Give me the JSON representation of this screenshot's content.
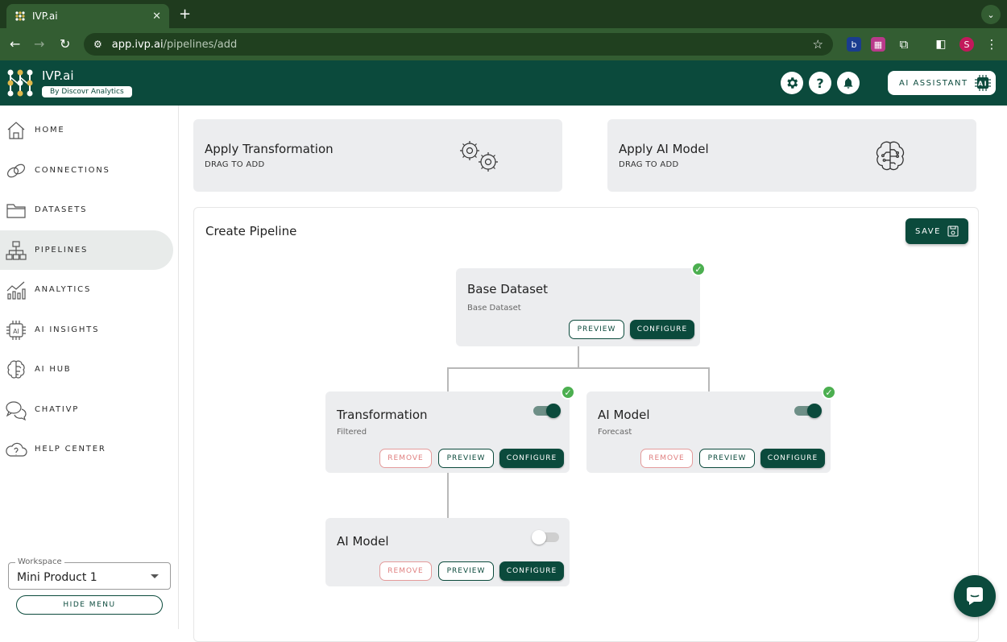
{
  "browser": {
    "tab_title": "IVP.ai",
    "tab_close": "✕",
    "new_tab": "+",
    "url_host": "app.ivp.ai",
    "url_path": "/pipelines/add",
    "profile_initial": "S"
  },
  "app": {
    "brand": "IVP.ai",
    "byline": "By Discovr Analytics",
    "ai_assistant_label": "AI ASSISTANT",
    "accent_color": "#0b4a3c"
  },
  "sidebar": {
    "items": [
      {
        "label": "HOME",
        "icon": "home-icon"
      },
      {
        "label": "CONNECTIONS",
        "icon": "link-icon"
      },
      {
        "label": "DATASETS",
        "icon": "folder-icon"
      },
      {
        "label": "PIPELINES",
        "icon": "pipeline-icon",
        "active": true
      },
      {
        "label": "ANALYTICS",
        "icon": "chart-icon"
      },
      {
        "label": "AI INSIGHTS",
        "icon": "ai-chip-icon"
      },
      {
        "label": "AI HUB",
        "icon": "brain-icon"
      },
      {
        "label": "CHATIVP",
        "icon": "chat-bubbles-icon"
      },
      {
        "label": "HELP CENTER",
        "icon": "cloud-icon"
      }
    ],
    "workspace_legend": "Workspace",
    "workspace_value": "Mini Product 1",
    "hide_menu": "HIDE MENU"
  },
  "drag_cards": [
    {
      "title": "Apply Transformation",
      "subtitle": "DRAG TO ADD",
      "icon": "gears-icon"
    },
    {
      "title": "Apply AI Model",
      "subtitle": "DRAG TO ADD",
      "icon": "brain-icon"
    }
  ],
  "pipeline": {
    "title": "Create Pipeline",
    "save_label": "SAVE",
    "nodes": {
      "base": {
        "title": "Base Dataset",
        "subtitle": "Base Dataset",
        "preview": "PREVIEW",
        "configure": "CONFIGURE",
        "checked": true
      },
      "transform": {
        "title": "Transformation",
        "subtitle": "Filtered",
        "remove": "REMOVE",
        "preview": "PREVIEW",
        "configure": "CONFIGURE",
        "checked": true,
        "enabled": true
      },
      "model_right": {
        "title": "AI Model",
        "subtitle": "Forecast",
        "remove": "REMOVE",
        "preview": "PREVIEW",
        "configure": "CONFIGURE",
        "checked": true,
        "enabled": true
      },
      "model_bottom": {
        "title": "AI Model",
        "subtitle": "",
        "remove": "REMOVE",
        "preview": "PREVIEW",
        "configure": "CONFIGURE",
        "checked": false,
        "enabled": false
      }
    }
  }
}
